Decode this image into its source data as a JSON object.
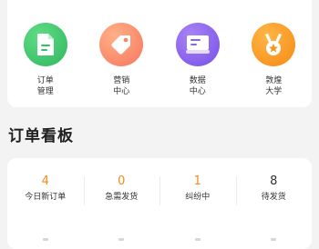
{
  "quick_actions": [
    {
      "label_line1": "订单",
      "label_line2": "管理",
      "icon": "document-icon",
      "color": "#35c16a"
    },
    {
      "label_line1": "营销",
      "label_line2": "中心",
      "icon": "tag-icon",
      "color": "#f9836a"
    },
    {
      "label_line1": "数据",
      "label_line2": "中心",
      "icon": "data-card-icon",
      "color": "#8a63ee"
    },
    {
      "label_line1": "敦煌",
      "label_line2": "大学",
      "icon": "medal-icon",
      "color": "#f7961f"
    }
  ],
  "order_board": {
    "title": "订单看板",
    "items": [
      {
        "value": "4",
        "label": "今日新订单",
        "value_color": "#f5891a"
      },
      {
        "value": "0",
        "label": "急需发货",
        "value_color": "#f5891a"
      },
      {
        "value": "1",
        "label": "纠纷中",
        "value_color": "#f5891a"
      },
      {
        "value": "8",
        "label": "待发货",
        "value_color": "#333333"
      }
    ]
  }
}
